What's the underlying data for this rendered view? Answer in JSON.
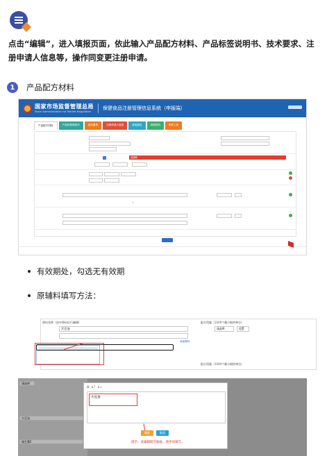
{
  "intro": "点击“编辑”，进入填报页面，依此输入产品配方材料、产品标签说明书、技术要求、注册申请人信息等，操作同变更注册申请。",
  "step": {
    "number": "1",
    "label": "产品配方材料"
  },
  "shot1": {
    "org_cn": "国家市场监督管理总局",
    "org_en": "State Administration for Market Regulation",
    "system_title": "保健食品注册管理信息系统（申报端）",
    "tabs": [
      "产品配方材料",
      "产品标签说明书",
      "技术要求",
      "注册申请人信息",
      "检验报告",
      "其他材料",
      "附件上传"
    ],
    "warning": "请按照"
  },
  "bullets": [
    "有效期处，勾选无有效期",
    "原辅料填写方法："
  ],
  "shot2": {
    "raw_name_label": "原料名称（选中原料后行编辑）",
    "amount_label": "配方用量（1000个最小制剂单位）",
    "dropdown_value": "请选择",
    "select_value": "设置",
    "input_value": "大豆油",
    "add_link": "添加原料",
    "focused_value": "维生素E",
    "suggestion": "维生素E"
  },
  "shot3": {
    "select_value": "请选择",
    "row1": "大豆油",
    "row2": "维生素E",
    "editor_text": "大豆油",
    "ok": "确定",
    "cancel": "取消",
    "tip": "提示：此编辑框可粘贴，请手动填写。"
  }
}
